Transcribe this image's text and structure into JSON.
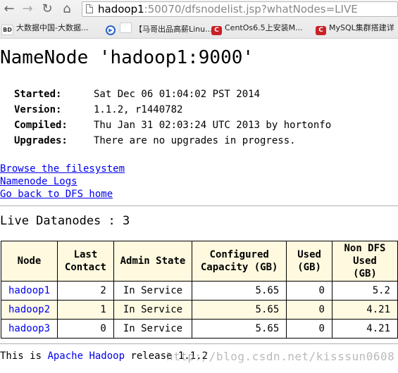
{
  "browser": {
    "url_host": "hadoop1",
    "url_rest": ":50070/dfsnodelist.jsp?whatNodes=LIVE",
    "bookmarks": [
      {
        "icon": "BD",
        "label": "大数据中国-大数据..."
      },
      {
        "icon": "play",
        "label": ""
      },
      {
        "icon": "page",
        "label": "【马哥出品高薪Linu..."
      },
      {
        "icon": "C",
        "label": "CentOs6.5上安装M..."
      },
      {
        "icon": "C",
        "label": "MySQL集群搭建详"
      }
    ]
  },
  "page": {
    "title": "NameNode 'hadoop1:9000'",
    "info": [
      {
        "key": "Started:",
        "value": "Sat Dec 06 01:04:02 PST 2014"
      },
      {
        "key": "Version:",
        "value": "1.1.2, r1440782"
      },
      {
        "key": "Compiled:",
        "value": "Thu Jan 31 02:03:24 UTC 2013 by hortonfo"
      },
      {
        "key": "Upgrades:",
        "value": "There are no upgrades in progress."
      }
    ],
    "links": [
      "Browse the filesystem",
      "Namenode Logs",
      "Go back to DFS home"
    ],
    "live_heading": "Live Datanodes : 3",
    "table": {
      "headers": [
        "Node",
        "Last Contact",
        "Admin State",
        "Configured Capacity (GB)",
        "Used (GB)",
        "Non DFS Used (GB)"
      ],
      "rows": [
        [
          "hadoop1",
          "2",
          "In Service",
          "5.65",
          "0",
          "5.2"
        ],
        [
          "hadoop2",
          "1",
          "In Service",
          "5.65",
          "0",
          "4.21"
        ],
        [
          "hadoop3",
          "0",
          "In Service",
          "5.65",
          "0",
          "4.21"
        ]
      ]
    },
    "footer_prefix": "This is ",
    "footer_link": "Apache Hadoop",
    "footer_suffix": " release 1.1.2",
    "watermark": "http://blog.csdn.net/kisssun0608"
  }
}
